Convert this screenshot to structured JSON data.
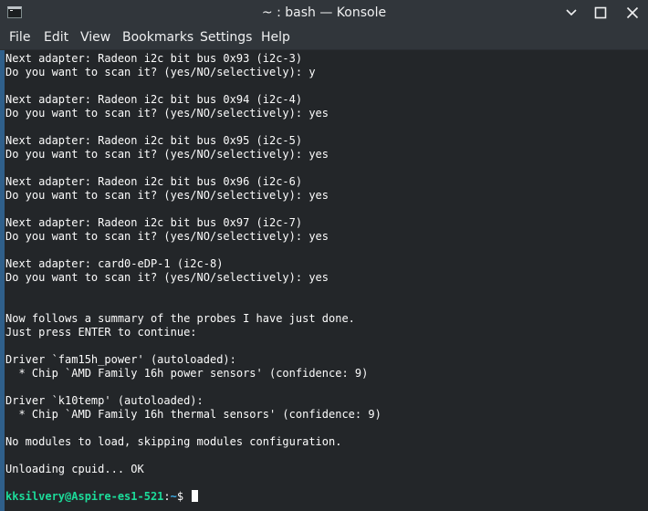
{
  "window": {
    "title": "~ : bash — Konsole",
    "icons": {
      "app": "terminal-icon",
      "minimize": "chevron-down-icon",
      "maximize": "square-icon",
      "close": "close-icon"
    }
  },
  "menu": [
    "File",
    "Edit",
    "View",
    "Bookmarks",
    "Settings",
    "Help"
  ],
  "terminal": {
    "lines": [
      "Next adapter: Radeon i2c bit bus 0x93 (i2c-3)",
      "Do you want to scan it? (yes/NO/selectively): y",
      "",
      "Next adapter: Radeon i2c bit bus 0x94 (i2c-4)",
      "Do you want to scan it? (yes/NO/selectively): yes",
      "",
      "Next adapter: Radeon i2c bit bus 0x95 (i2c-5)",
      "Do you want to scan it? (yes/NO/selectively): yes",
      "",
      "Next adapter: Radeon i2c bit bus 0x96 (i2c-6)",
      "Do you want to scan it? (yes/NO/selectively): yes",
      "",
      "Next adapter: Radeon i2c bit bus 0x97 (i2c-7)",
      "Do you want to scan it? (yes/NO/selectively): yes",
      "",
      "Next adapter: card0-eDP-1 (i2c-8)",
      "Do you want to scan it? (yes/NO/selectively): yes",
      "",
      "",
      "Now follows a summary of the probes I have just done.",
      "Just press ENTER to continue:",
      "",
      "Driver `fam15h_power' (autoloaded):",
      "  * Chip `AMD Family 16h power sensors' (confidence: 9)",
      "",
      "Driver `k10temp' (autoloaded):",
      "  * Chip `AMD Family 16h thermal sensors' (confidence: 9)",
      "",
      "No modules to load, skipping modules configuration.",
      "",
      "Unloading cpuid... OK"
    ],
    "prompt": {
      "user_host": "kksilvery@Aspire-es1-521",
      "separator": ":",
      "path": "~",
      "symbol": "$ "
    },
    "colors": {
      "background": "#232629",
      "foreground": "#fcfcfc",
      "user_host": "#1cdc9a",
      "path": "#3daee9",
      "accent": "#2f5f8a"
    }
  }
}
